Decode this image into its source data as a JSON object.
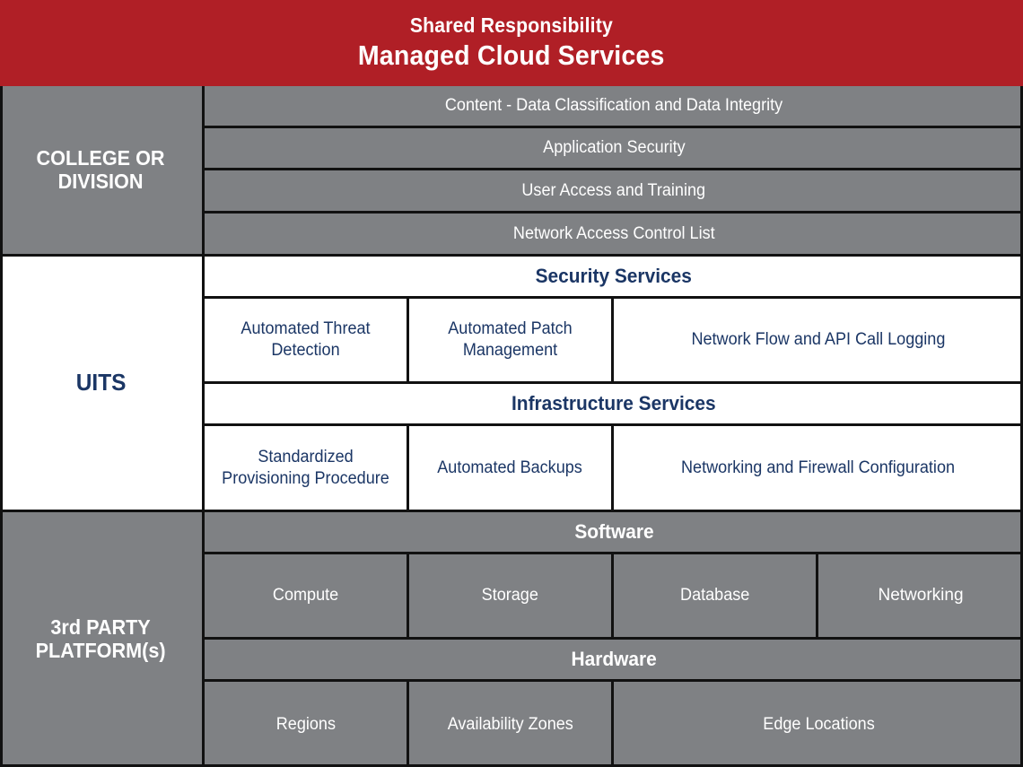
{
  "banner": {
    "subtitle": "Shared Responsibility",
    "title": "Managed Cloud Services",
    "background_color": "#b01f26",
    "text_color": "#ffffff"
  },
  "colors": {
    "red": "#b01f26",
    "grey": "#7f8184",
    "navy": "#1b3665",
    "white": "#ffffff",
    "border": "#111111"
  },
  "sections": [
    {
      "label": "COLLEGE OR DIVISION",
      "label_line1": "COLLEGE OR",
      "label_line2": "DIVISION",
      "theme": "grey",
      "rows": [
        {
          "kind": "full",
          "text": "Content - Data Classification and Data Integrity"
        },
        {
          "kind": "full",
          "text": "Application Security"
        },
        {
          "kind": "full",
          "text": "User Access and Training"
        },
        {
          "kind": "full",
          "text": "Network Access Control List"
        }
      ]
    },
    {
      "label": "UITS",
      "theme": "white",
      "rows": [
        {
          "kind": "header",
          "text": "Security Services"
        },
        {
          "kind": "cells",
          "cells": [
            "Automated Threat Detection",
            "Automated Patch Management",
            "Network Flow and API Call Logging"
          ]
        },
        {
          "kind": "header",
          "text": "Infrastructure Services"
        },
        {
          "kind": "cells",
          "cells": [
            "Standardized Provisioning Procedure",
            "Automated Backups",
            "Networking and Firewall Configuration"
          ]
        }
      ]
    },
    {
      "label": "3rd PARTY PLATFORM(s)",
      "label_line1": "3rd PARTY",
      "label_line2": "PLATFORM(s)",
      "theme": "grey",
      "rows": [
        {
          "kind": "header",
          "text": "Software"
        },
        {
          "kind": "cells",
          "cells": [
            "Compute",
            "Storage",
            "Database",
            "Networking"
          ]
        },
        {
          "kind": "header",
          "text": "Hardware"
        },
        {
          "kind": "cells",
          "cells": [
            "Regions",
            "Availability Zones",
            "Edge Locations"
          ]
        }
      ]
    }
  ],
  "college": {
    "label_line1": "COLLEGE OR",
    "label_line2": "DIVISION",
    "row1": "Content - Data Classification and Data Integrity",
    "row2": "Application Security",
    "row3": "User Access and Training",
    "row4": "Network Access Control List"
  },
  "uits": {
    "label": "UITS",
    "security_header": "Security Services",
    "security_c1": "Automated Threat Detection",
    "security_c2": "Automated Patch Management",
    "security_c3": "Network Flow and API Call Logging",
    "infra_header": "Infrastructure Services",
    "infra_c1": "Standardized Provisioning Procedure",
    "infra_c2": "Automated Backups",
    "infra_c3": "Networking and Firewall Configuration"
  },
  "third_party": {
    "label_line1": "3rd PARTY",
    "label_line2": "PLATFORM(s)",
    "software_header": "Software",
    "software_c1": "Compute",
    "software_c2": "Storage",
    "software_c3": "Database",
    "software_c4": "Networking",
    "hardware_header": "Hardware",
    "hardware_c1": "Regions",
    "hardware_c2": "Availability Zones",
    "hardware_c3": "Edge Locations"
  }
}
